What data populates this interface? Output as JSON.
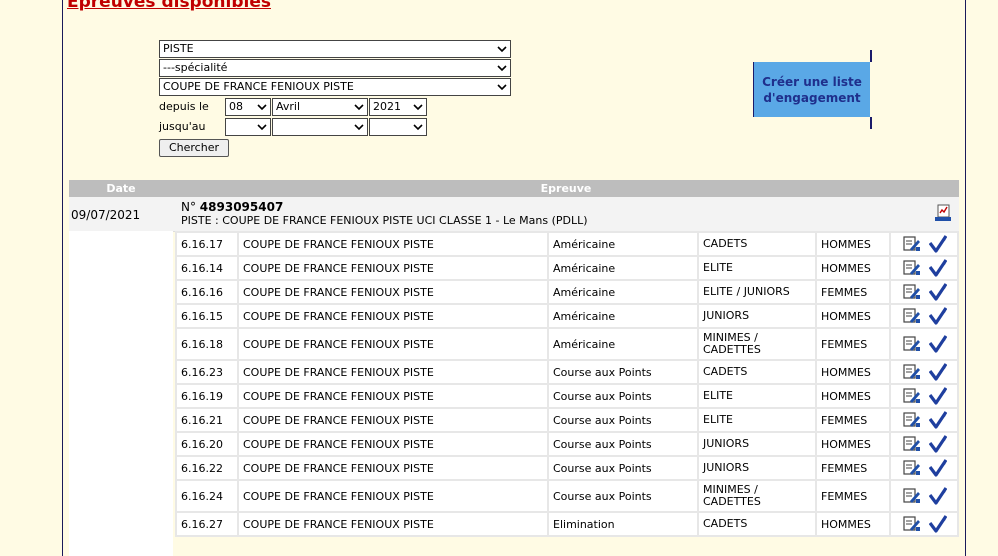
{
  "section": {
    "title": "Epreuves disponibles"
  },
  "filters": {
    "discipline": "PISTE",
    "specialite": "---spécialité",
    "competition": "COUPE DE FRANCE FENIOUX PISTE",
    "depuis_label": "depuis le",
    "jusquau_label": "jusqu'au",
    "from_day": "08",
    "from_month": "Avril",
    "from_year": "2021",
    "to_day": "",
    "to_month": "",
    "to_year": "",
    "search_label": "Chercher"
  },
  "create_button": {
    "line1": "Créer une liste",
    "line2": "d'engagement"
  },
  "table": {
    "col_date": "Date",
    "col_epreuve": "Epreuve",
    "event": {
      "date": "09/07/2021",
      "number_prefix": "N° ",
      "number": "4893095407",
      "description": "PISTE : COUPE DE FRANCE FENIOUX PISTE UCI CLASSE 1 - Le Mans (PDLL)"
    },
    "rows": [
      {
        "code": "6.16.17",
        "competition": "COUPE DE FRANCE FENIOUX PISTE",
        "type": "Américaine",
        "category": "CADETS",
        "sex": "HOMMES"
      },
      {
        "code": "6.16.14",
        "competition": "COUPE DE FRANCE FENIOUX PISTE",
        "type": "Américaine",
        "category": "ELITE",
        "sex": "HOMMES"
      },
      {
        "code": "6.16.16",
        "competition": "COUPE DE FRANCE FENIOUX PISTE",
        "type": "Américaine",
        "category": "ELITE / JUNIORS",
        "sex": "FEMMES"
      },
      {
        "code": "6.16.15",
        "competition": "COUPE DE FRANCE FENIOUX PISTE",
        "type": "Américaine",
        "category": "JUNIORS",
        "sex": "HOMMES"
      },
      {
        "code": "6.16.18",
        "competition": "COUPE DE FRANCE FENIOUX PISTE",
        "type": "Américaine",
        "category": "MINIMES / CADETTES",
        "sex": "FEMMES"
      },
      {
        "code": "6.16.23",
        "competition": "COUPE DE FRANCE FENIOUX PISTE",
        "type": "Course aux Points",
        "category": "CADETS",
        "sex": "HOMMES"
      },
      {
        "code": "6.16.19",
        "competition": "COUPE DE FRANCE FENIOUX PISTE",
        "type": "Course aux Points",
        "category": "ELITE",
        "sex": "HOMMES"
      },
      {
        "code": "6.16.21",
        "competition": "COUPE DE FRANCE FENIOUX PISTE",
        "type": "Course aux Points",
        "category": "ELITE",
        "sex": "FEMMES"
      },
      {
        "code": "6.16.20",
        "competition": "COUPE DE FRANCE FENIOUX PISTE",
        "type": "Course aux Points",
        "category": "JUNIORS",
        "sex": "HOMMES"
      },
      {
        "code": "6.16.22",
        "competition": "COUPE DE FRANCE FENIOUX PISTE",
        "type": "Course aux Points",
        "category": "JUNIORS",
        "sex": "FEMMES"
      },
      {
        "code": "6.16.24",
        "competition": "COUPE DE FRANCE FENIOUX PISTE",
        "type": "Course aux Points",
        "category": "MINIMES / CADETTES",
        "sex": "FEMMES"
      },
      {
        "code": "6.16.27",
        "competition": "COUPE DE FRANCE FENIOUX PISTE",
        "type": "Elimination",
        "category": "CADETS",
        "sex": "HOMMES"
      }
    ]
  },
  "icons": {
    "edit": "edit-entry-icon",
    "validate": "validate-check-icon",
    "pdf": "pdf-export-icon",
    "chevron": "chevron-down-icon"
  },
  "colors": {
    "background": "#fffbe4",
    "title": "#c00000",
    "button": "#5aa8e6",
    "header": "#bdbdbd"
  }
}
